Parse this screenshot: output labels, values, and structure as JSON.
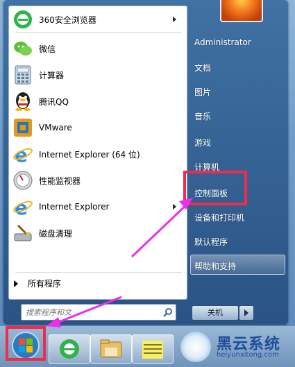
{
  "programs": [
    {
      "label": "360安全浏览器",
      "icon": "360-browser-icon",
      "has_submenu": true
    },
    {
      "label": "微信",
      "icon": "wechat-icon",
      "has_submenu": false
    },
    {
      "label": "计算器",
      "icon": "calculator-icon",
      "has_submenu": false
    },
    {
      "label": "腾讯QQ",
      "icon": "qq-penguin-icon",
      "has_submenu": false
    },
    {
      "label": "VMware",
      "icon": "vmware-icon",
      "has_submenu": false
    },
    {
      "label": "Internet Explorer (64 位)",
      "icon": "internet-explorer-icon",
      "has_submenu": false
    },
    {
      "label": "性能监视器",
      "icon": "performance-monitor-icon",
      "has_submenu": false
    },
    {
      "label": "Internet Explorer",
      "icon": "internet-explorer-icon",
      "has_submenu": true
    },
    {
      "label": "磁盘清理",
      "icon": "disk-cleanup-icon",
      "has_submenu": false
    }
  ],
  "all_programs": "所有程序",
  "search": {
    "placeholder": "搜索程序和文"
  },
  "right": {
    "user": "Administrator",
    "documents": "文档",
    "pictures": "图片",
    "music": "音乐",
    "games": "游戏",
    "computer": "计算机",
    "control_panel": "控制面板",
    "devices_printers": "设备和打印机",
    "default_programs": "默认程序",
    "help_support": "帮助和支持"
  },
  "shutdown": {
    "label": "关机"
  },
  "watermark": {
    "title": "黑云系统",
    "url": "heiyunxitong.com"
  },
  "colors": {
    "highlight_red": "#f22a4c",
    "arrow_magenta": "#ee2ee8",
    "menu_blue": "#3c6ea0"
  }
}
